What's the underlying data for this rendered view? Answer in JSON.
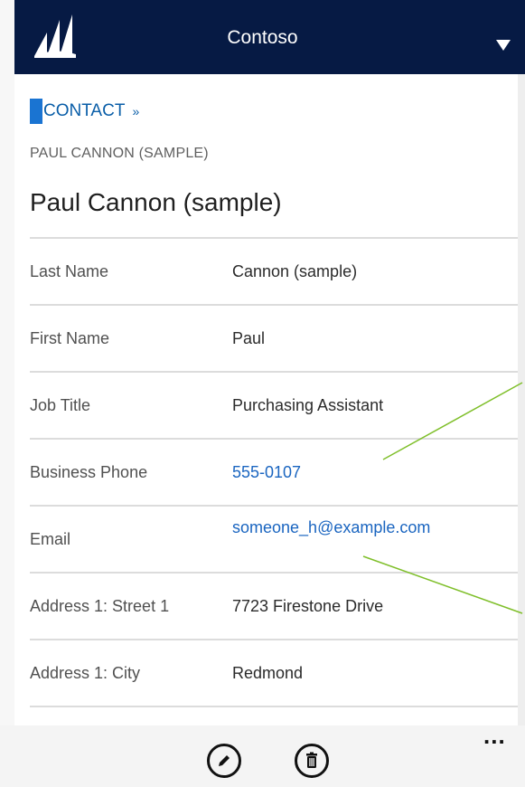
{
  "header": {
    "org_name": "Contoso",
    "logo_icon": "dynamics-logo-icon",
    "menu_icon": "caret-down-icon",
    "bg_color": "#061a44"
  },
  "record": {
    "entity_label_first": "C",
    "entity_label_rest": "ONTACT",
    "entity_arrow": "»",
    "subtitle": "PAUL CANNON (SAMPLE)",
    "title": "Paul Cannon (sample)"
  },
  "fields": [
    {
      "label": "Last Name",
      "value": "Cannon (sample)"
    },
    {
      "label": "First Name",
      "value": "Paul"
    },
    {
      "label": "Job Title",
      "value": "Purchasing Assistant"
    },
    {
      "label": "Business Phone",
      "value": "555-0107"
    },
    {
      "label": "Email",
      "value": "someone_h@example.com"
    },
    {
      "label": "Address 1: Street 1",
      "value": "7723 Firestone Drive"
    },
    {
      "label": "Address 1: City",
      "value": "Redmond"
    }
  ],
  "toolbar": {
    "edit_icon": "pencil-icon",
    "delete_icon": "trash-icon",
    "more_label": "...",
    "more_icon": "more-ellipsis-icon"
  },
  "colors": {
    "link": "#1a65c0",
    "callout_line": "#7fbf2a"
  }
}
